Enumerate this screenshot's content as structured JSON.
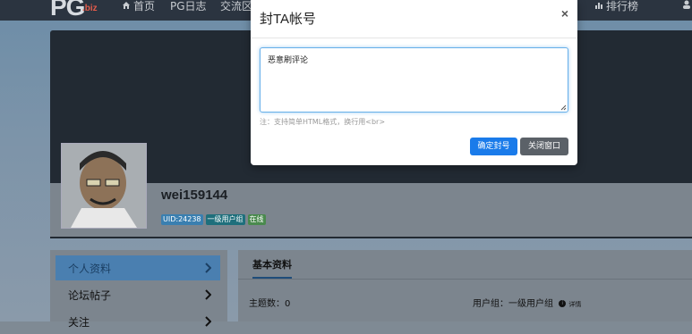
{
  "navbar": {
    "logo": "PG",
    "logo_sub": ".biz",
    "items": [
      "首页",
      "PG日志",
      "交流区"
    ],
    "right_item": "排行榜"
  },
  "profile": {
    "username": "wei159144",
    "badges": [
      {
        "text": "UID:24238",
        "color": "#3a94d8"
      },
      {
        "text": "一级用户组",
        "color": "#1f8a9a"
      },
      {
        "text": "在线",
        "color": "#4caf50"
      }
    ]
  },
  "sidebar": {
    "items": [
      {
        "label": "个人资料",
        "active": true
      },
      {
        "label": "论坛帖子",
        "active": false
      },
      {
        "label": "关注",
        "active": false
      }
    ]
  },
  "content": {
    "tab": "基本资料",
    "topics_label": "主题数：",
    "topics_value": "0",
    "group_label": "用户组：",
    "group_value": "一级用户组",
    "detail_link": "详情"
  },
  "modal": {
    "title": "封TA帐号",
    "close": "×",
    "reason_value": "恶意刷评论",
    "hint": "注：支持简单HTML格式，换行用<br>",
    "confirm_label": "确定封号",
    "cancel_label": "关闭窗口"
  }
}
